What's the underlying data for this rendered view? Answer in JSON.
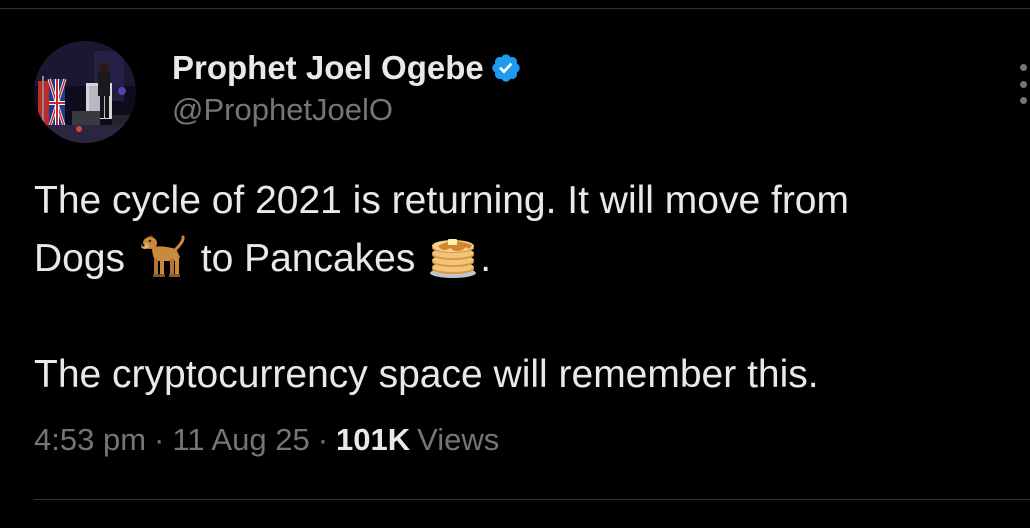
{
  "author": {
    "display_name": "Prophet Joel Ogebe",
    "handle": "@ProphetJoelO",
    "verified": true,
    "verified_color": "#1d9bf0"
  },
  "tweet": {
    "line1": "The cycle of 2021 is returning. It will move from",
    "line2_a": "Dogs",
    "line2_b": "to Pancakes",
    "line2_c": ".",
    "line3": "The cryptocurrency space will remember this.",
    "emojis": [
      "dog-emoji",
      "pancakes-emoji"
    ]
  },
  "meta": {
    "time": "4:53 pm",
    "separator": "·",
    "date": "11 Aug 25",
    "views_count": "101K",
    "views_label": "Views"
  },
  "colors": {
    "background": "#000000",
    "text": "#e7e9ea",
    "secondary": "#71767b",
    "divider": "#2f3336"
  }
}
